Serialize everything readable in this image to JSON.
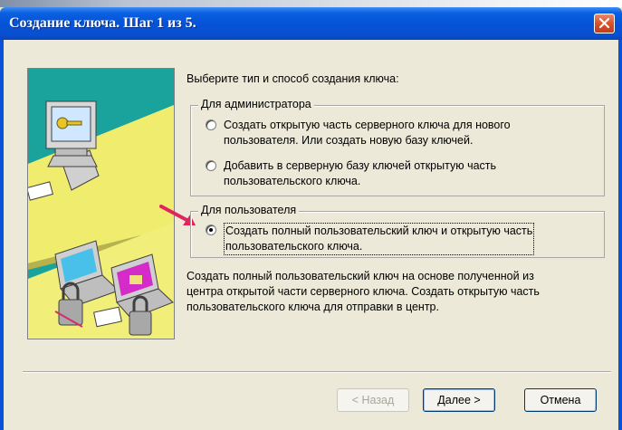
{
  "window": {
    "title": "Создание ключа. Шаг 1 из 5.",
    "close_symbol": "✕"
  },
  "heading": "Выберите тип и способ создания ключа:",
  "admin_group": {
    "title": "Для администратора",
    "options": [
      {
        "label": "Создать открытую часть серверного ключа для нового\nпользователя. Или создать новую базу ключей.",
        "checked": false
      },
      {
        "label": "Добавить в серверную базу ключей открытую часть\nпользовательского ключа.",
        "checked": false
      }
    ]
  },
  "user_group": {
    "title": "Для пользователя",
    "options": [
      {
        "label": "Создать полный пользовательский ключ и открытую часть\nпользовательского ключа.",
        "checked": true
      }
    ]
  },
  "description": "  Создать полный пользовательский ключ на основе полученной из\nцентра открытой части серверного ключа. Создать открытую часть\nпользовательского ключа для отправки в центр.",
  "buttons": {
    "back": "< Назад",
    "next": "Далее >",
    "cancel": "Отмена"
  },
  "colors": {
    "titlebar": "#0553d8",
    "dialog_bg": "#ece9d8",
    "arrow": "#e0245e"
  },
  "icons": [
    "close-icon",
    "wizard-illustration",
    "arrow-pointer-icon",
    "computer-key-icon",
    "laptop-lock-icon"
  ]
}
